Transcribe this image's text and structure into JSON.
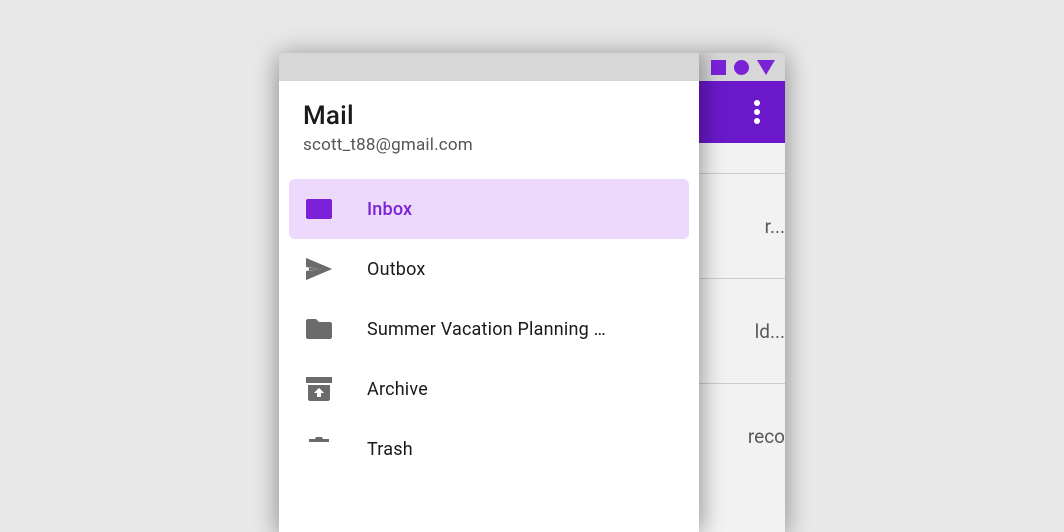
{
  "drawer": {
    "title": "Mail",
    "subtitle": "scott_t88@gmail.com",
    "items": [
      {
        "label": "Inbox",
        "icon": "mail-icon",
        "active": true
      },
      {
        "label": "Outbox",
        "icon": "send-icon",
        "active": false
      },
      {
        "label": "Summer Vacation Planning …",
        "icon": "folder-icon",
        "active": false
      },
      {
        "label": "Archive",
        "icon": "archive-icon",
        "active": false
      },
      {
        "label": "Trash",
        "icon": "trash-icon",
        "active": false
      }
    ]
  },
  "behind": {
    "rows": [
      "",
      "r...",
      "ld...",
      "reco"
    ]
  },
  "colors": {
    "primary": "#7b22d8",
    "primaryDark": "#6a18c9",
    "activeBg": "#ecd9fc"
  }
}
